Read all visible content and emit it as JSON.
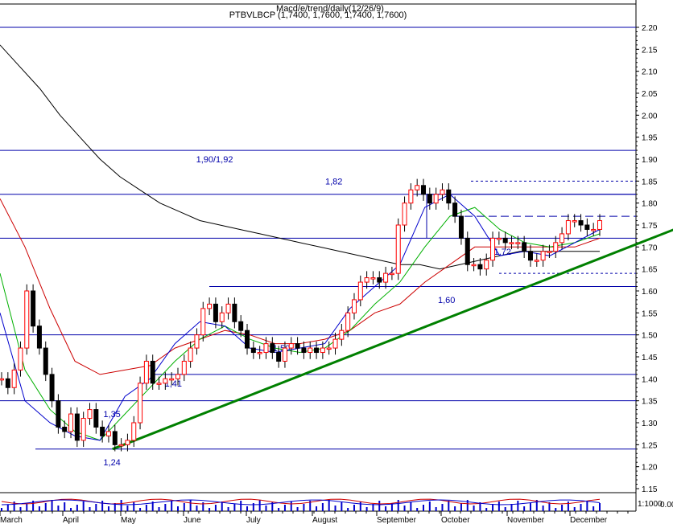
{
  "header": {
    "title_top": "Macd/e/trend/daily(12/26/9)",
    "subtitle": "PTBVLBCP (1,7400, 1,7600, 1,7400, 1,7600)"
  },
  "volume_scale_label": "1:1000",
  "volume_axis_label": "0.00",
  "colors": {
    "price_up": "#ff0000",
    "price_down": "#000000",
    "ma_short": "#0000cc",
    "ma_mid": "#00b000",
    "ma_long": "#cc0000",
    "ma_200": "#000000",
    "trend": "#008000",
    "level": "#0000aa"
  },
  "chart_data": {
    "type": "line",
    "title": "PTBVLBCP (1,7400, 1,7600, 1,7400, 1,7600)",
    "ylim": [
      1.1,
      2.25
    ],
    "yticks": [
      1.15,
      1.2,
      1.25,
      1.3,
      1.35,
      1.4,
      1.45,
      1.5,
      1.55,
      1.6,
      1.65,
      1.7,
      1.75,
      1.8,
      1.85,
      1.9,
      1.95,
      2.0,
      2.05,
      2.1,
      2.15,
      2.2
    ],
    "ytick_labels": [
      "1.15",
      "1.20",
      "1.25",
      "1.30",
      "1.35",
      "1.40",
      "1.45",
      "1.50",
      "1.55",
      "1.60",
      "1.65",
      "1.70",
      "1.75",
      "1.80",
      "1.85",
      "1.90",
      "1.95",
      "2.00",
      "2.05",
      "2.10",
      "2.15",
      "2.20"
    ],
    "months": [
      "March",
      "April",
      "May",
      "June",
      "July",
      "August",
      "September",
      "October",
      "November",
      "December"
    ],
    "horizontal_levels": [
      1.24,
      1.35,
      1.41,
      1.5,
      1.61,
      1.72,
      1.82,
      1.92,
      2.2
    ],
    "level_labels": [
      {
        "text": "1,24",
        "value": 1.21,
        "month": "June",
        "month_frac": 0.7
      },
      {
        "text": "1,35",
        "value": 1.32,
        "month": "June",
        "month_frac": 0.7
      },
      {
        "text": "1,41",
        "value": 1.39,
        "month": "July",
        "month_frac": 0.7
      },
      {
        "text": "1,50",
        "value": 1.47,
        "month": "August",
        "month_frac": 1.4
      },
      {
        "text": "1,60",
        "value": 1.58,
        "month": "October",
        "month_frac": 1.95
      },
      {
        "text": "1,72",
        "value": 1.69,
        "month": "November",
        "month_frac": 1.8
      },
      {
        "text": "1,82",
        "value": 1.85,
        "month": "August",
        "month_frac": 2.2
      },
      {
        "text": "1,90/1,92",
        "value": 1.9,
        "month": "June",
        "month_frac": 2.2
      }
    ],
    "trendline": {
      "start": [
        0.92,
        1.24
      ],
      "end": [
        9.92,
        1.75
      ]
    },
    "close": [
      1.4,
      1.38,
      1.42,
      1.47,
      1.6,
      1.52,
      1.47,
      1.41,
      1.35,
      1.29,
      1.28,
      1.32,
      1.26,
      1.31,
      1.33,
      1.29,
      1.27,
      1.28,
      1.25,
      1.25,
      1.26,
      1.3,
      1.39,
      1.44,
      1.39,
      1.39,
      1.4,
      1.4,
      1.41,
      1.44,
      1.47,
      1.5,
      1.56,
      1.57,
      1.53,
      1.55,
      1.57,
      1.53,
      1.51,
      1.47,
      1.46,
      1.46,
      1.48,
      1.46,
      1.44,
      1.47,
      1.48,
      1.47,
      1.46,
      1.47,
      1.46,
      1.47,
      1.47,
      1.49,
      1.51,
      1.55,
      1.58,
      1.62,
      1.63,
      1.63,
      1.62,
      1.64,
      1.64,
      1.75,
      1.8,
      1.83,
      1.84,
      1.82,
      1.8,
      1.82,
      1.83,
      1.8,
      1.77,
      1.72,
      1.66,
      1.66,
      1.65,
      1.67,
      1.72,
      1.72,
      1.71,
      1.71,
      1.71,
      1.69,
      1.67,
      1.67,
      1.69,
      1.69,
      1.71,
      1.73,
      1.76,
      1.76,
      1.75,
      1.74,
      1.74,
      1.76
    ],
    "ma_200": [
      2.16,
      2.11,
      2.06,
      2.0,
      1.95,
      1.9,
      1.86,
      1.83,
      1.8,
      1.78,
      1.76,
      1.75,
      1.74,
      1.73,
      1.72,
      1.71,
      1.7,
      1.69,
      1.68,
      1.67,
      1.66,
      1.66,
      1.65,
      1.66,
      1.67,
      1.68,
      1.69,
      1.69,
      1.69,
      1.69,
      1.69
    ],
    "ma_long": [
      1.81,
      1.7,
      1.56,
      1.44,
      1.41,
      1.42,
      1.43,
      1.47,
      1.49,
      1.51,
      1.5,
      1.48,
      1.48,
      1.49,
      1.51,
      1.55,
      1.57,
      1.62,
      1.66,
      1.7,
      1.7,
      1.7,
      1.7,
      1.7,
      1.72
    ],
    "ma_mid": [
      1.64,
      1.42,
      1.33,
      1.28,
      1.26,
      1.32,
      1.38,
      1.44,
      1.49,
      1.52,
      1.49,
      1.47,
      1.46,
      1.47,
      1.51,
      1.57,
      1.62,
      1.7,
      1.77,
      1.79,
      1.74,
      1.71,
      1.7,
      1.71,
      1.73
    ],
    "ma_short": [
      1.55,
      1.35,
      1.3,
      1.27,
      1.26,
      1.36,
      1.4,
      1.48,
      1.53,
      1.52,
      1.47,
      1.46,
      1.47,
      1.48,
      1.56,
      1.61,
      1.66,
      1.79,
      1.82,
      1.77,
      1.68,
      1.69,
      1.68,
      1.71,
      1.74
    ]
  }
}
